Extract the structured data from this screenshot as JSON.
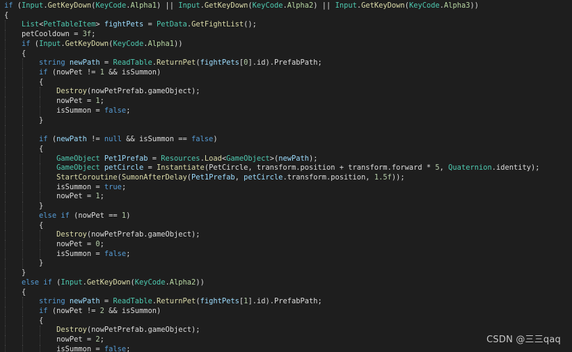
{
  "colors": {
    "background": "#1e1e1e",
    "plain": "#dcdcdc",
    "keyword": "#569cd6",
    "type": "#4ec9b0",
    "method": "#dcdcaa",
    "variable": "#9cdcfe",
    "number": "#b5cea8",
    "enum_member": "#b8d7a3",
    "watermark": "#c8c8c8"
  },
  "editor": {
    "lines": [
      {
        "indent": 0,
        "tokens": [
          [
            "keyword",
            "if"
          ],
          [
            "plain",
            " ("
          ],
          [
            "type",
            "Input"
          ],
          [
            "plain",
            "."
          ],
          [
            "method",
            "GetKeyDown"
          ],
          [
            "plain",
            "("
          ],
          [
            "type",
            "KeyCode"
          ],
          [
            "plain",
            "."
          ],
          [
            "enum",
            "Alpha1"
          ],
          [
            "plain",
            ") || "
          ],
          [
            "type",
            "Input"
          ],
          [
            "plain",
            "."
          ],
          [
            "method",
            "GetKeyDown"
          ],
          [
            "plain",
            "("
          ],
          [
            "type",
            "KeyCode"
          ],
          [
            "plain",
            "."
          ],
          [
            "enum",
            "Alpha2"
          ],
          [
            "plain",
            ") || "
          ],
          [
            "type",
            "Input"
          ],
          [
            "plain",
            "."
          ],
          [
            "method",
            "GetKeyDown"
          ],
          [
            "plain",
            "("
          ],
          [
            "type",
            "KeyCode"
          ],
          [
            "plain",
            "."
          ],
          [
            "enum",
            "Alpha3"
          ],
          [
            "plain",
            "))"
          ]
        ]
      },
      {
        "indent": 0,
        "tokens": [
          [
            "plain",
            "{"
          ]
        ]
      },
      {
        "indent": 1,
        "tokens": [
          [
            "type",
            "List"
          ],
          [
            "plain",
            "<"
          ],
          [
            "type",
            "PetTableItem"
          ],
          [
            "plain",
            "> "
          ],
          [
            "var",
            "fightPets"
          ],
          [
            "plain",
            " = "
          ],
          [
            "type",
            "PetData"
          ],
          [
            "plain",
            "."
          ],
          [
            "method",
            "GetFightList"
          ],
          [
            "plain",
            "();"
          ]
        ]
      },
      {
        "indent": 1,
        "tokens": [
          [
            "plain",
            "petCooldown = "
          ],
          [
            "number",
            "3f"
          ],
          [
            "plain",
            ";"
          ]
        ]
      },
      {
        "indent": 1,
        "tokens": [
          [
            "keyword",
            "if"
          ],
          [
            "plain",
            " ("
          ],
          [
            "type",
            "Input"
          ],
          [
            "plain",
            "."
          ],
          [
            "method",
            "GetKeyDown"
          ],
          [
            "plain",
            "("
          ],
          [
            "type",
            "KeyCode"
          ],
          [
            "plain",
            "."
          ],
          [
            "enum",
            "Alpha1"
          ],
          [
            "plain",
            "))"
          ]
        ]
      },
      {
        "indent": 1,
        "tokens": [
          [
            "plain",
            "{"
          ]
        ]
      },
      {
        "indent": 2,
        "tokens": [
          [
            "keyword",
            "string"
          ],
          [
            "plain",
            " "
          ],
          [
            "var",
            "newPath"
          ],
          [
            "plain",
            " = "
          ],
          [
            "type",
            "ReadTable"
          ],
          [
            "plain",
            "."
          ],
          [
            "method",
            "ReturnPet"
          ],
          [
            "plain",
            "("
          ],
          [
            "var",
            "fightPets"
          ],
          [
            "plain",
            "["
          ],
          [
            "number",
            "0"
          ],
          [
            "plain",
            "].id).PrefabPath;"
          ]
        ]
      },
      {
        "indent": 2,
        "tokens": [
          [
            "keyword",
            "if"
          ],
          [
            "plain",
            " (nowPet != "
          ],
          [
            "number",
            "1"
          ],
          [
            "plain",
            " && isSummon)"
          ]
        ]
      },
      {
        "indent": 2,
        "tokens": [
          [
            "plain",
            "{"
          ]
        ]
      },
      {
        "indent": 3,
        "tokens": [
          [
            "method",
            "Destroy"
          ],
          [
            "plain",
            "(nowPetPrefab.gameObject);"
          ]
        ]
      },
      {
        "indent": 3,
        "tokens": [
          [
            "plain",
            "nowPet = "
          ],
          [
            "number",
            "1"
          ],
          [
            "plain",
            ";"
          ]
        ]
      },
      {
        "indent": 3,
        "tokens": [
          [
            "plain",
            "isSummon = "
          ],
          [
            "keyword",
            "false"
          ],
          [
            "plain",
            ";"
          ]
        ]
      },
      {
        "indent": 2,
        "tokens": [
          [
            "plain",
            "}"
          ]
        ]
      },
      {
        "indent": 2,
        "tokens": []
      },
      {
        "indent": 2,
        "tokens": [
          [
            "keyword",
            "if"
          ],
          [
            "plain",
            " ("
          ],
          [
            "var",
            "newPath"
          ],
          [
            "plain",
            " != "
          ],
          [
            "keyword",
            "null"
          ],
          [
            "plain",
            " && isSummon == "
          ],
          [
            "keyword",
            "false"
          ],
          [
            "plain",
            ")"
          ]
        ]
      },
      {
        "indent": 2,
        "tokens": [
          [
            "plain",
            "{"
          ]
        ]
      },
      {
        "indent": 3,
        "tokens": [
          [
            "type",
            "GameObject"
          ],
          [
            "plain",
            " "
          ],
          [
            "var",
            "Pet1Prefab"
          ],
          [
            "plain",
            " = "
          ],
          [
            "type",
            "Resources"
          ],
          [
            "plain",
            "."
          ],
          [
            "method",
            "Load"
          ],
          [
            "plain",
            "<"
          ],
          [
            "type",
            "GameObject"
          ],
          [
            "plain",
            ">("
          ],
          [
            "var",
            "newPath"
          ],
          [
            "plain",
            ");"
          ]
        ]
      },
      {
        "indent": 3,
        "tokens": [
          [
            "type",
            "GameObject"
          ],
          [
            "plain",
            " "
          ],
          [
            "var",
            "petCircle"
          ],
          [
            "plain",
            " = "
          ],
          [
            "method",
            "Instantiate"
          ],
          [
            "plain",
            "(PetCircle, transform.position + transform.forward * "
          ],
          [
            "number",
            "5"
          ],
          [
            "plain",
            ", "
          ],
          [
            "type",
            "Quaternion"
          ],
          [
            "plain",
            ".identity);"
          ]
        ]
      },
      {
        "indent": 3,
        "tokens": [
          [
            "method",
            "StartCoroutine"
          ],
          [
            "plain",
            "("
          ],
          [
            "method",
            "SumonAfterDelay"
          ],
          [
            "plain",
            "("
          ],
          [
            "var",
            "Pet1Prefab"
          ],
          [
            "plain",
            ", "
          ],
          [
            "var",
            "petCircle"
          ],
          [
            "plain",
            ".transform.position, "
          ],
          [
            "number",
            "1.5f"
          ],
          [
            "plain",
            "));"
          ]
        ]
      },
      {
        "indent": 3,
        "tokens": [
          [
            "plain",
            "isSummon = "
          ],
          [
            "keyword",
            "true"
          ],
          [
            "plain",
            ";"
          ]
        ]
      },
      {
        "indent": 3,
        "tokens": [
          [
            "plain",
            "nowPet = "
          ],
          [
            "number",
            "1"
          ],
          [
            "plain",
            ";"
          ]
        ]
      },
      {
        "indent": 2,
        "tokens": [
          [
            "plain",
            "}"
          ]
        ]
      },
      {
        "indent": 2,
        "tokens": [
          [
            "keyword",
            "else if"
          ],
          [
            "plain",
            " (nowPet == "
          ],
          [
            "number",
            "1"
          ],
          [
            "plain",
            ")"
          ]
        ]
      },
      {
        "indent": 2,
        "tokens": [
          [
            "plain",
            "{"
          ]
        ]
      },
      {
        "indent": 3,
        "tokens": [
          [
            "method",
            "Destroy"
          ],
          [
            "plain",
            "(nowPetPrefab.gameObject);"
          ]
        ]
      },
      {
        "indent": 3,
        "tokens": [
          [
            "plain",
            "nowPet = "
          ],
          [
            "number",
            "0"
          ],
          [
            "plain",
            ";"
          ]
        ]
      },
      {
        "indent": 3,
        "tokens": [
          [
            "plain",
            "isSummon = "
          ],
          [
            "keyword",
            "false"
          ],
          [
            "plain",
            ";"
          ]
        ]
      },
      {
        "indent": 2,
        "tokens": [
          [
            "plain",
            "}"
          ]
        ]
      },
      {
        "indent": 1,
        "tokens": [
          [
            "plain",
            "}"
          ]
        ]
      },
      {
        "indent": 1,
        "tokens": [
          [
            "keyword",
            "else if"
          ],
          [
            "plain",
            " ("
          ],
          [
            "type",
            "Input"
          ],
          [
            "plain",
            "."
          ],
          [
            "method",
            "GetKeyDown"
          ],
          [
            "plain",
            "("
          ],
          [
            "type",
            "KeyCode"
          ],
          [
            "plain",
            "."
          ],
          [
            "enum",
            "Alpha2"
          ],
          [
            "plain",
            "))"
          ]
        ]
      },
      {
        "indent": 1,
        "tokens": [
          [
            "plain",
            "{"
          ]
        ]
      },
      {
        "indent": 2,
        "tokens": [
          [
            "keyword",
            "string"
          ],
          [
            "plain",
            " "
          ],
          [
            "var",
            "newPath"
          ],
          [
            "plain",
            " = "
          ],
          [
            "type",
            "ReadTable"
          ],
          [
            "plain",
            "."
          ],
          [
            "method",
            "ReturnPet"
          ],
          [
            "plain",
            "("
          ],
          [
            "var",
            "fightPets"
          ],
          [
            "plain",
            "["
          ],
          [
            "number",
            "1"
          ],
          [
            "plain",
            "].id).PrefabPath;"
          ]
        ]
      },
      {
        "indent": 2,
        "tokens": [
          [
            "keyword",
            "if"
          ],
          [
            "plain",
            " (nowPet != "
          ],
          [
            "number",
            "2"
          ],
          [
            "plain",
            " && isSummon)"
          ]
        ]
      },
      {
        "indent": 2,
        "tokens": [
          [
            "plain",
            "{"
          ]
        ]
      },
      {
        "indent": 3,
        "tokens": [
          [
            "method",
            "Destroy"
          ],
          [
            "plain",
            "(nowPetPrefab.gameObject);"
          ]
        ]
      },
      {
        "indent": 3,
        "tokens": [
          [
            "plain",
            "nowPet = "
          ],
          [
            "number",
            "2"
          ],
          [
            "plain",
            ";"
          ]
        ]
      },
      {
        "indent": 3,
        "tokens": [
          [
            "plain",
            "isSummon = "
          ],
          [
            "keyword",
            "false"
          ],
          [
            "plain",
            ";"
          ]
        ]
      }
    ]
  },
  "watermark": {
    "text": "CSDN @三三qaq"
  }
}
